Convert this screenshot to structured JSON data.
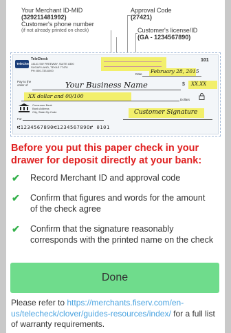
{
  "annotations": {
    "merchant_id_label": "Your Merchant ID-MID",
    "merchant_id_value": "(329211481992)",
    "approval_code_label": "Approval Code",
    "approval_code_value": "(27421)",
    "customer_phone_label": "Customer's phone number",
    "customer_phone_note": "(if not already printed on check)",
    "customer_license_label": "Customer's license/ID",
    "customer_license_value": "(GA - 1234567890)"
  },
  "check": {
    "bank_brand": "TeleCheck",
    "bank_address_1": "TeleCheck",
    "bank_address_2": "14141 SW FREEWAY, SUITE #300",
    "bank_address_3": "SUGAR LAND, TEXAS 77478",
    "bank_address_4": "PH: 800-733-6000",
    "check_number": "101",
    "date_label": "Date",
    "date_value": "February 28, 2015",
    "pay_to_label": "Pay to the order of",
    "payee": "Your Business Name",
    "amount_symbol": "$",
    "amount": "XX.XX",
    "amount_words": "XX dollar and 00/100",
    "dollars_label": "Dollars",
    "consumer_bank_1": "Consumer Bank",
    "consumer_bank_2": "Bank Address",
    "consumer_bank_3": "City, State Zip Code",
    "for_label": "For",
    "signature": "Customer Signature",
    "micr_line": "⑆1234567890⑆123456789O⑈ 0101"
  },
  "warning": "Before you put this paper check in your drawer for deposit directly at your bank:",
  "checklist": [
    "Record Merchant ID and approval code",
    "Confirm that figures and words for the amount of the check agree",
    "Confirm that the signature reasonably corresponds with the printed name on the check"
  ],
  "done_label": "Done",
  "refer": {
    "prefix": "Please refer to ",
    "link": "https://merchants.fiserv.com/en-us/telecheck/clover/guides-resources/index/",
    "suffix": " for a full list of warranty requirements."
  },
  "colors": {
    "warning": "#e02020",
    "check_mark": "#37b24d",
    "done_button": "#6fdc8c",
    "link": "#4aa3e0",
    "highlight": "#f2ef6b"
  },
  "icons": [
    "check-mark-icon",
    "bank-building-icon",
    "padlock-icon",
    "telecheck-logo-icon"
  ]
}
